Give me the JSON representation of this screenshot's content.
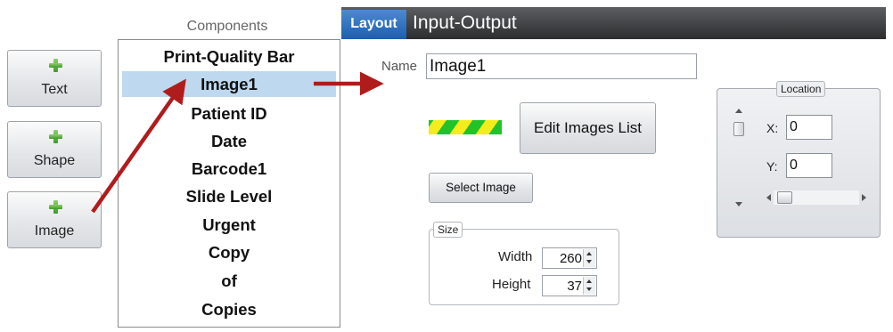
{
  "add_buttons": [
    {
      "label": "Text",
      "icon": "plus-icon"
    },
    {
      "label": "Shape",
      "icon": "plus-icon"
    },
    {
      "label": "Image",
      "icon": "plus-icon"
    }
  ],
  "components": {
    "title": "Components",
    "items": [
      "Print-Quality Bar",
      "Image1",
      "Patient ID",
      "Date",
      "Barcode1",
      "Slide Level",
      "Urgent",
      "Copy",
      "of",
      "Copies"
    ],
    "selected_index": 1,
    "selected_color": "#bdd8ef"
  },
  "tabs": [
    {
      "label": "Layout",
      "active": true
    },
    {
      "label": "Input-Output",
      "active": false
    }
  ],
  "properties": {
    "name_label": "Name",
    "name_value": "Image1",
    "edit_images_label": "Edit Images List",
    "select_image_label": "Select Image",
    "size": {
      "legend": "Size",
      "width_label": "Width",
      "width_value": "260",
      "height_label": "Height",
      "height_value": "37"
    },
    "location": {
      "legend": "Location",
      "x_label": "X:",
      "x_value": "0",
      "y_label": "Y:",
      "y_value": "0"
    }
  },
  "colors": {
    "tab_active": "#2a6cc0",
    "header_bg": "#3a3b3d",
    "annotation_arrow": "#b01c1c",
    "stripe_green": "#21c22a",
    "stripe_yellow": "#f4ec1c"
  }
}
